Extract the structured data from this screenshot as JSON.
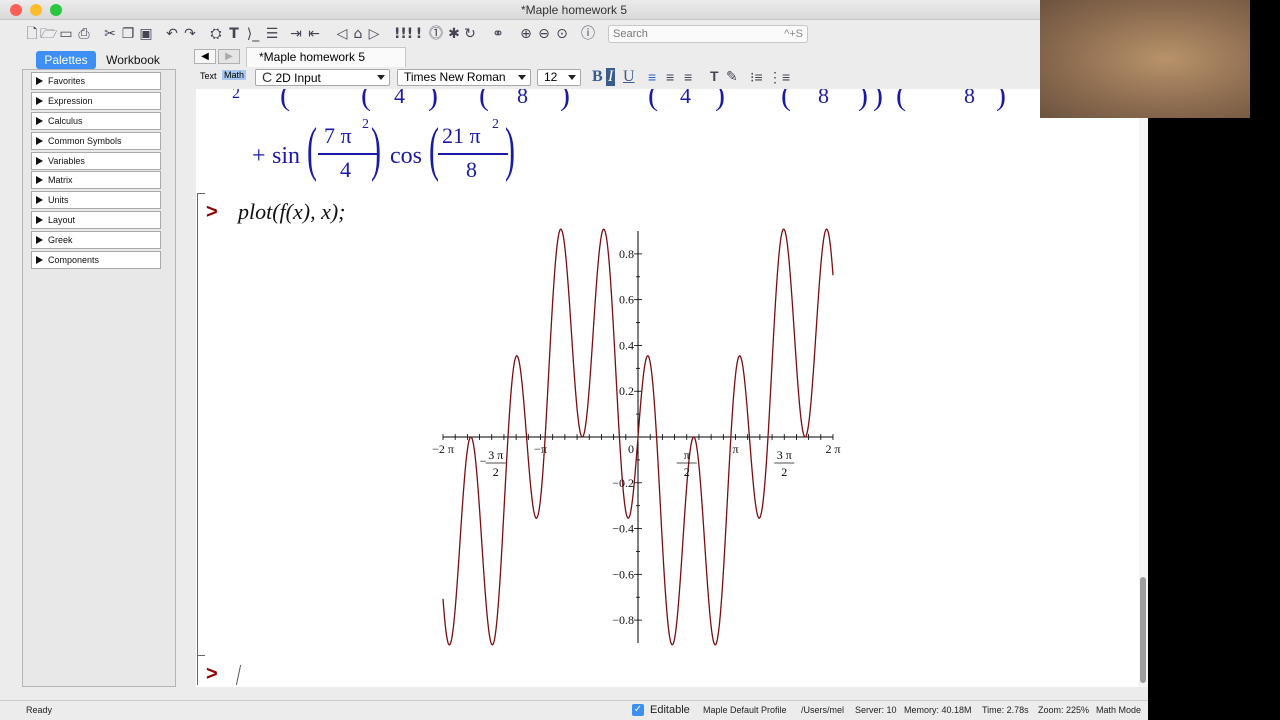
{
  "window": {
    "title": "*Maple homework 5"
  },
  "toolbar": {
    "search_placeholder": "Search",
    "search_shortcut": "^+S"
  },
  "panel": {
    "tabs": [
      "Palettes",
      "Workbook"
    ],
    "items": [
      "Favorites",
      "Expression",
      "Calculus",
      "Common Symbols",
      "Variables",
      "Matrix",
      "Units",
      "Layout",
      "Greek",
      "Components"
    ]
  },
  "document": {
    "tab_name": "*Maple homework 5"
  },
  "format": {
    "text_mode": "Text",
    "math_mode": "Math",
    "input_mode": "2D Input",
    "font": "Times New Roman",
    "size": "12"
  },
  "worksheet": {
    "partial_top_left": "2",
    "partial_fracs": [
      "4",
      "8",
      "4",
      "8",
      "8"
    ],
    "expr_plus": "+",
    "sin_label": "sin",
    "cos_label": "cos",
    "sin_num": "7 π",
    "sin_exp": "2",
    "sin_den": "4",
    "cos_num": "21 π",
    "cos_exp": "2",
    "cos_den": "8",
    "command": "plot(f(x), x);",
    "prompt": ">"
  },
  "chart_data": {
    "type": "line",
    "title": "",
    "xlabel": "",
    "ylabel": "",
    "xlim": [
      -6.2832,
      6.2832
    ],
    "ylim": [
      -0.9,
      0.9
    ],
    "x_ticks": [
      {
        "value": -6.2832,
        "label": "−2 π"
      },
      {
        "value": -4.7124,
        "label": "3 π / 2",
        "sign": "−"
      },
      {
        "value": -3.1416,
        "label": "−π"
      },
      {
        "value": 0,
        "label": "0"
      },
      {
        "value": 1.5708,
        "label": "π / 2"
      },
      {
        "value": 3.1416,
        "label": "π"
      },
      {
        "value": 4.7124,
        "label": "3 π / 2"
      },
      {
        "value": 6.2832,
        "label": "2 π"
      }
    ],
    "y_ticks": [
      {
        "value": 0.8,
        "label": "0.8"
      },
      {
        "value": 0.6,
        "label": "0.6"
      },
      {
        "value": 0.4,
        "label": "0.4"
      },
      {
        "value": 0.2,
        "label": "0.2"
      },
      {
        "value": -0.2,
        "label": "−0.2"
      },
      {
        "value": -0.4,
        "label": "−0.4"
      },
      {
        "value": -0.6,
        "label": "−0.6"
      },
      {
        "value": -0.8,
        "label": "−0.8"
      }
    ],
    "series": [
      {
        "color": "#7a0d12",
        "function": "sin(7x/4)·cos(21x/8)"
      }
    ],
    "grid": false
  },
  "status": {
    "ready": "Ready",
    "editable": "Editable",
    "profile": "Maple Default Profile",
    "path": "/Users/mel",
    "server": "Server: 10",
    "memory": "Memory: 40.18M",
    "time": "Time: 2.78s",
    "zoom": "Zoom: 225%",
    "mode": "Math Mode"
  }
}
